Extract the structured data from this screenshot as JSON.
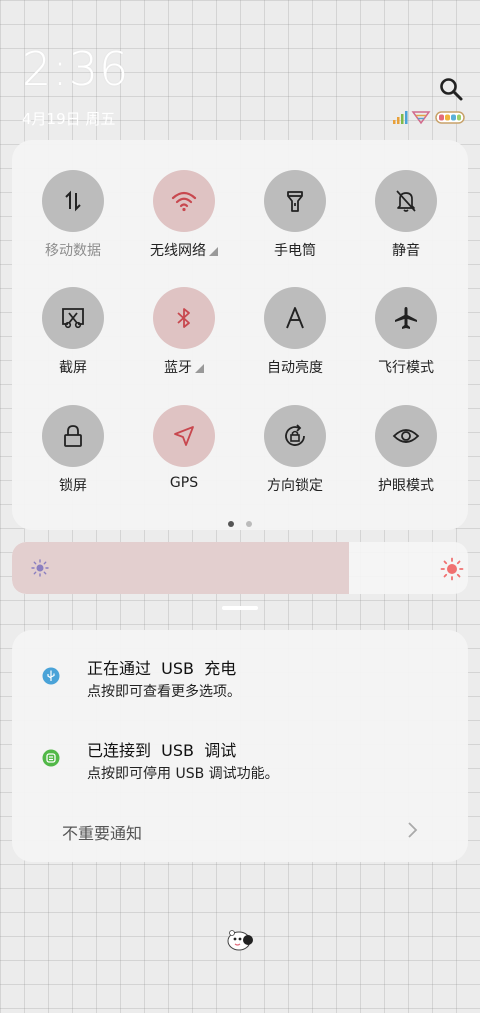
{
  "status": {
    "time": "2:36",
    "date": "4月19日 周五",
    "search_icon": "search-icon",
    "signal_icon": "signal-bars-icon",
    "wifi_icon": "wifi-icon",
    "battery_icon": "battery-icon"
  },
  "quick_settings": {
    "tiles": [
      {
        "label": "移动数据",
        "icon": "mobile-data-icon",
        "active": false,
        "dimmed": true
      },
      {
        "label": "无线网络",
        "icon": "wifi-icon",
        "active": true,
        "expandable": true
      },
      {
        "label": "手电筒",
        "icon": "flashlight-icon",
        "active": false
      },
      {
        "label": "静音",
        "icon": "mute-bell-icon",
        "active": false
      },
      {
        "label": "截屏",
        "icon": "screenshot-icon",
        "active": false
      },
      {
        "label": "蓝牙",
        "icon": "bluetooth-icon",
        "active": true,
        "expandable": true
      },
      {
        "label": "自动亮度",
        "icon": "auto-brightness-icon",
        "active": false
      },
      {
        "label": "飞行模式",
        "icon": "airplane-icon",
        "active": false
      },
      {
        "label": "锁屏",
        "icon": "lock-icon",
        "active": false
      },
      {
        "label": "GPS",
        "icon": "location-arrow-icon",
        "active": true
      },
      {
        "label": "方向锁定",
        "icon": "rotation-lock-icon",
        "active": false
      },
      {
        "label": "护眼模式",
        "icon": "eye-icon",
        "active": false
      }
    ],
    "page_index": 1,
    "page_count": 2
  },
  "brightness": {
    "level": 0.74
  },
  "notifications": [
    {
      "title": "正在通过  USB  充电",
      "text": "点按即可查看更多选项。",
      "icon": "usb-icon"
    },
    {
      "title": "已连接到  USB  调试",
      "text": "点按即可停用 USB 调试功能。",
      "icon": "android-debug-icon"
    }
  ],
  "unimportant_label": "不重要通知",
  "colors": {
    "active_tile": "#dfc3c3",
    "inactive_tile": "#bcbcbc",
    "active_icon": "#c8484f",
    "brightness_fill": "#e3cfcf"
  }
}
